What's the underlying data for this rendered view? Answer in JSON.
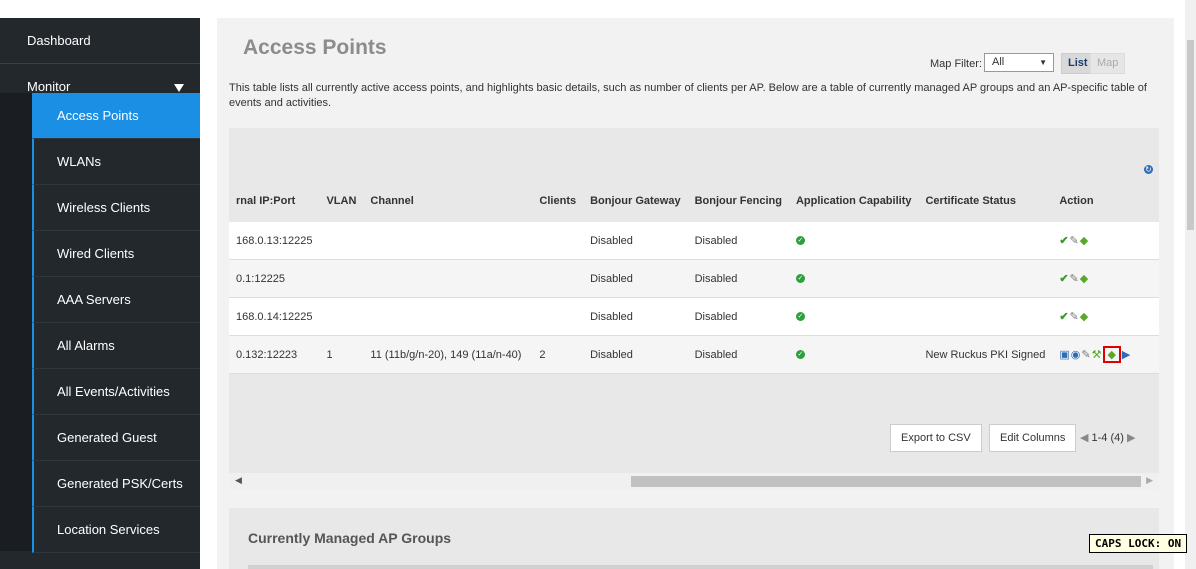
{
  "sidebar": {
    "dashboard": "Dashboard",
    "monitor": "Monitor",
    "items": [
      {
        "label": "Access Points",
        "active": true
      },
      {
        "label": "WLANs"
      },
      {
        "label": "Wireless Clients"
      },
      {
        "label": "Wired Clients"
      },
      {
        "label": "AAA Servers"
      },
      {
        "label": "All Alarms"
      },
      {
        "label": "All Events/Activities"
      },
      {
        "label": "Generated Guest"
      },
      {
        "label": "Generated PSK/Certs"
      },
      {
        "label": "Location Services"
      }
    ]
  },
  "main": {
    "title": "Access Points",
    "map_filter_label": "Map Filter:",
    "map_filter_value": "All",
    "list_label": "List",
    "map_label": "Map",
    "description": "This table lists all currently active access points, and highlights basic details, such as number of clients per AP. Below are a table of currently managed AP groups and an AP-specific table of events and activities."
  },
  "table": {
    "headers": [
      "rnal IP:Port",
      "VLAN",
      "Channel",
      "Clients",
      "Bonjour Gateway",
      "Bonjour Fencing",
      "Application Capability",
      "Certificate Status",
      "Action"
    ],
    "rows": [
      {
        "ip": "168.0.13:12225",
        "vlan": "",
        "channel": "",
        "clients": "",
        "gateway": "Disabled",
        "fencing": "Disabled",
        "cert": ""
      },
      {
        "ip": "0.1:12225",
        "vlan": "",
        "channel": "",
        "clients": "",
        "gateway": "Disabled",
        "fencing": "Disabled",
        "cert": ""
      },
      {
        "ip": "168.0.14:12225",
        "vlan": "",
        "channel": "",
        "clients": "",
        "gateway": "Disabled",
        "fencing": "Disabled",
        "cert": ""
      },
      {
        "ip": "0.132:12223",
        "vlan": "1",
        "channel": "11 (11b/g/n-20), 149 (11a/n-40)",
        "clients": "2",
        "gateway": "Disabled",
        "fencing": "Disabled",
        "cert": "New Ruckus PKI Signed"
      }
    ],
    "export_label": "Export to CSV",
    "edit_columns_label": "Edit Columns",
    "pager": "1-4 (4)"
  },
  "groups": {
    "title": "Currently Managed AP Groups"
  },
  "caps_lock": "CAPS LOCK: ON",
  "colors": {
    "sidebar_bg": "#23282d",
    "active_item": "#1a8fe3",
    "highlight_box": "#e00000"
  }
}
